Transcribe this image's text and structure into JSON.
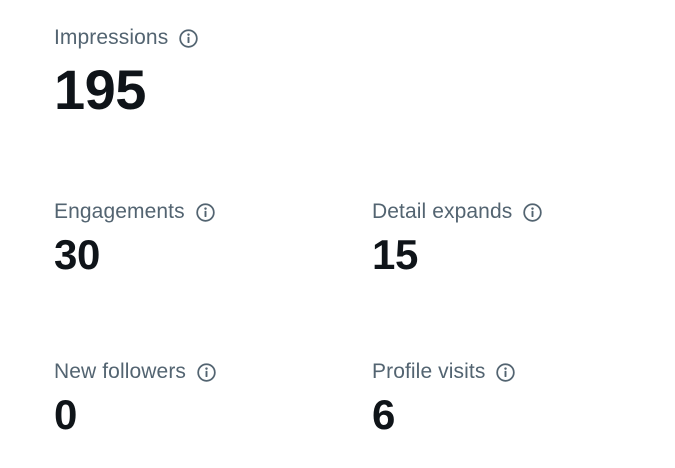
{
  "metrics": {
    "impressions": {
      "label": "Impressions",
      "value": "195",
      "icon": "info-icon"
    },
    "engagements": {
      "label": "Engagements",
      "value": "30",
      "icon": "info-icon"
    },
    "detail_expands": {
      "label": "Detail expands",
      "value": "15",
      "icon": "info-icon"
    },
    "new_followers": {
      "label": "New followers",
      "value": "0",
      "icon": "info-icon"
    },
    "profile_visits": {
      "label": "Profile visits",
      "value": "6",
      "icon": "info-icon"
    }
  },
  "colors": {
    "label": "#536471",
    "value": "#0f1419",
    "background": "#ffffff"
  }
}
